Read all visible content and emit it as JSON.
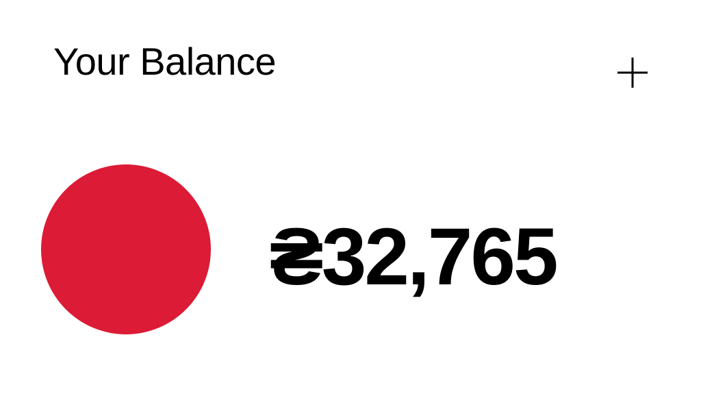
{
  "header": {
    "title": "Your Balance",
    "add_icon": "plus-icon"
  },
  "balance": {
    "amount": "₴32,765",
    "currency_symbol": "₴",
    "value": "32,765",
    "token_color": "#dc1b36"
  }
}
